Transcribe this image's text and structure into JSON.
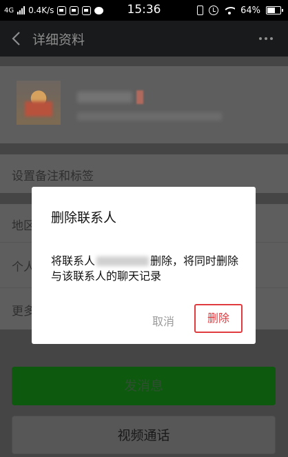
{
  "status_bar": {
    "network": "4G",
    "speed": "0.4K/s",
    "time": "15:36",
    "battery": "64%",
    "battery_level": 0.64
  },
  "header": {
    "title": "详细资料"
  },
  "profile": {
    "rows": {
      "notes": "设置备注和标签",
      "region": "地区",
      "personal": "个人",
      "more": "更多"
    },
    "message_button": "发消息",
    "video_button": "视频通话"
  },
  "dialog": {
    "title": "删除联系人",
    "message_prefix": "将联系人",
    "message_suffix": "删除，将同时删除与该联系人的聊天记录",
    "cancel_label": "取消",
    "delete_label": "删除"
  },
  "colors": {
    "accent_green": "#1aad19",
    "delete_red": "#e0393e"
  }
}
